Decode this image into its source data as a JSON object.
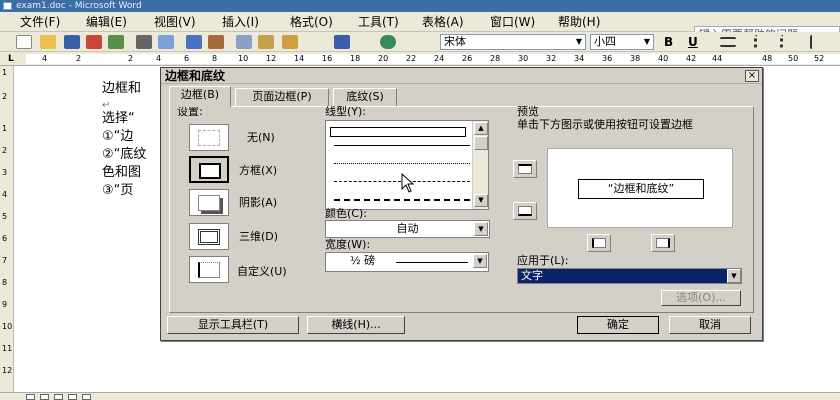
{
  "window": {
    "title": "exam1.doc - Microsoft Word"
  },
  "menu": {
    "items": [
      "文件(F)",
      "编辑(E)",
      "视图(V)",
      "插入(I)",
      "格式(O)",
      "工具(T)",
      "表格(A)",
      "窗口(W)",
      "帮助(H)"
    ],
    "help_placeholder": "键入需要帮助的问题"
  },
  "toolbar": {
    "font_name": "宋体",
    "font_size": "小四",
    "bold": "B",
    "underline": "U"
  },
  "ruler": {
    "marks": [
      "L",
      "4",
      "2",
      "2",
      "4",
      "6",
      "8",
      "10",
      "12",
      "14",
      "16",
      "18",
      "20",
      "22",
      "24",
      "26",
      "28",
      "30",
      "32",
      "34",
      "36",
      "38",
      "40",
      "42",
      "44",
      "48",
      "50",
      "52"
    ],
    "vmarks": [
      "1",
      "2",
      "1",
      "2",
      "3",
      "4",
      "5",
      "6",
      "7",
      "8",
      "9",
      "10",
      "11",
      "12"
    ]
  },
  "document": {
    "lines": [
      "边框和",
      "↵",
      "选择“",
      "①“边",
      "②“底纹",
      "色和图",
      "③“页"
    ]
  },
  "dialog": {
    "title": "边框和底纹",
    "close": "×",
    "tabs": [
      "边框(B)",
      "页面边框(P)",
      "底纹(S)"
    ],
    "settings_label": "设置:",
    "settings": [
      "无(N)",
      "方框(X)",
      "阴影(A)",
      "三维(D)",
      "自定义(U)"
    ],
    "line_style_label": "线型(Y):",
    "color_label": "颜色(C):",
    "color_value": "自动",
    "width_label": "宽度(W):",
    "width_value": "½ 磅",
    "preview_label": "预览",
    "preview_hint": "单击下方图示或使用按钮可设置边框",
    "preview_text": "“边框和底纹”",
    "apply_label": "应用于(L):",
    "apply_value": "文字",
    "options_button": "选项(O)...",
    "toolbar_button": "显示工具栏(T)",
    "hline_button": "横线(H)...",
    "ok_button": "确定",
    "cancel_button": "取消"
  }
}
